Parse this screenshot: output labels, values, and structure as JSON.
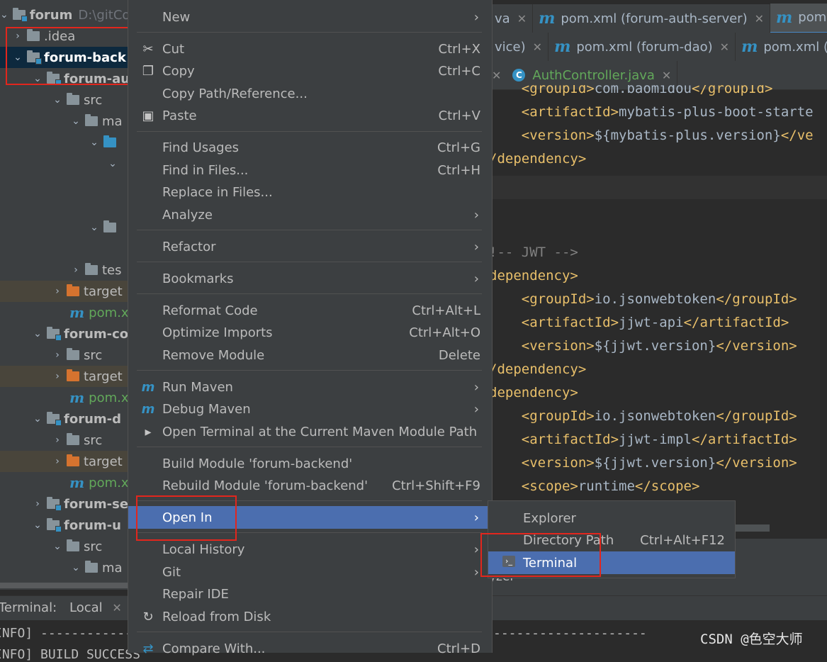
{
  "tree": {
    "root_name": "forum",
    "root_path": "D:\\gitCo",
    "items": [
      {
        "label": ".idea"
      },
      {
        "label": "forum-back"
      },
      {
        "label": "forum-au"
      },
      {
        "label": "src"
      },
      {
        "label": "ma"
      },
      {
        "label": "tes"
      },
      {
        "label": "target"
      },
      {
        "label": "pom.x"
      },
      {
        "label": "forum-co"
      },
      {
        "label": "src"
      },
      {
        "label": "target"
      },
      {
        "label": "pom.x"
      },
      {
        "label": "forum-d"
      },
      {
        "label": "src"
      },
      {
        "label": "target"
      },
      {
        "label": "pom.x"
      },
      {
        "label": "forum-se"
      },
      {
        "label": "forum-u"
      },
      {
        "label": "src"
      },
      {
        "label": "ma"
      }
    ]
  },
  "tabs": {
    "row1": [
      {
        "label": "va"
      },
      {
        "label": "pom.xml (forum-auth-server)"
      },
      {
        "label": "pom.xn"
      }
    ],
    "row2": [
      {
        "label": "vice)"
      },
      {
        "label": "pom.xml (forum-dao)"
      },
      {
        "label": "pom.xml (fo"
      }
    ],
    "row3": [
      {
        "label": "AuthController.java"
      }
    ]
  },
  "code": {
    "lines": [
      {
        "indent": "    ",
        "open": "<groupId>",
        "text": "com.baomidou",
        "close": "</groupId>"
      },
      {
        "indent": "    ",
        "open": "<artifactId>",
        "text": "mybatis-plus-boot-starte",
        "close": ""
      },
      {
        "indent": "    ",
        "open": "<version>",
        "text": "${mybatis-plus.version}",
        "close": "</ve"
      },
      {
        "indent": "",
        "open": "/dependency>",
        "text": "",
        "close": ""
      },
      {
        "indent": "",
        "open": "",
        "text": "",
        "close": ""
      },
      {
        "indent": "",
        "open": "",
        "text": "",
        "close": ""
      },
      {
        "indent": "",
        "comment": "!-- JWT -->"
      },
      {
        "indent": "",
        "open": "dependency>",
        "text": "",
        "close": ""
      },
      {
        "indent": "    ",
        "open": "<groupId>",
        "text": "io.jsonwebtoken",
        "close": "</groupId>"
      },
      {
        "indent": "    ",
        "open": "<artifactId>",
        "text": "jjwt-api",
        "close": "</artifactId>"
      },
      {
        "indent": "    ",
        "open": "<version>",
        "text": "${jjwt.version}",
        "close": "</version>"
      },
      {
        "indent": "",
        "open": "/dependency>",
        "text": "",
        "close": ""
      },
      {
        "indent": "",
        "open": "dependency>",
        "text": "",
        "close": ""
      },
      {
        "indent": "    ",
        "open": "<groupId>",
        "text": "io.jsonwebtoken",
        "close": "</groupId>"
      },
      {
        "indent": "    ",
        "open": "<artifactId>",
        "text": "jjwt-impl",
        "close": "</artifactId>"
      },
      {
        "indent": "    ",
        "open": "<version>",
        "text": "${jjwt.version}",
        "close": "</version>"
      },
      {
        "indent": "    ",
        "open": "<scope>",
        "text": "runtime",
        "close": "</scope>"
      }
    ],
    "fragment": "yzer"
  },
  "menu": {
    "new": "New",
    "cut": "Cut",
    "cut_sc": "Ctrl+X",
    "copy": "Copy",
    "copy_sc": "Ctrl+C",
    "copy_path": "Copy Path/Reference...",
    "paste": "Paste",
    "paste_sc": "Ctrl+V",
    "find_usages": "Find Usages",
    "find_usages_sc": "Ctrl+G",
    "find_in_files": "Find in Files...",
    "find_in_files_sc": "Ctrl+H",
    "replace_in_files": "Replace in Files...",
    "analyze": "Analyze",
    "refactor": "Refactor",
    "bookmarks": "Bookmarks",
    "reformat": "Reformat Code",
    "reformat_sc": "Ctrl+Alt+L",
    "optimize": "Optimize Imports",
    "optimize_sc": "Ctrl+Alt+O",
    "remove_module": "Remove Module",
    "remove_module_sc": "Delete",
    "run_maven": "Run Maven",
    "debug_maven": "Debug Maven",
    "open_terminal_maven": "Open Terminal at the Current Maven Module Path",
    "build_module": "Build Module 'forum-backend'",
    "rebuild_module": "Rebuild Module 'forum-backend'",
    "rebuild_module_sc": "Ctrl+Shift+F9",
    "open_in": "Open In",
    "local_history": "Local History",
    "git": "Git",
    "repair_ide": "Repair IDE",
    "reload": "Reload from Disk",
    "compare": "Compare With...",
    "compare_sc": "Ctrl+D"
  },
  "submenu": {
    "explorer": "Explorer",
    "directory_path": "Directory Path",
    "directory_path_sc": "Ctrl+Alt+F12",
    "terminal": "Terminal"
  },
  "terminal": {
    "label": "Terminal:",
    "tab": "Local",
    "line1_prefix": "INFO] ------------",
    "line1_suffix": "--------------------",
    "line2": "INFO] BUILD SUCCESS"
  },
  "watermark": "CSDN @色空大师",
  "colors": {
    "highlight": "#4b6eaf",
    "annotation": "#e2261d",
    "menu_bg": "#3c3f41"
  }
}
